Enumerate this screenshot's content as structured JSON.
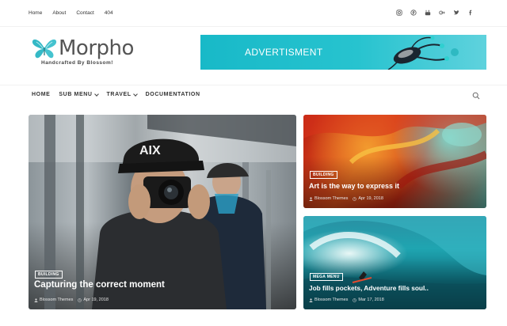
{
  "topbar": {
    "links": [
      "Home",
      "About",
      "Contact",
      "404"
    ],
    "social_icons": [
      "instagram-icon",
      "pinterest-icon",
      "youtube-icon",
      "google-plus-icon",
      "twitter-icon",
      "facebook-icon"
    ]
  },
  "header": {
    "logo_text": "Morpho",
    "tagline": "Handcrafted By Blossom!",
    "ad_text": "ADVERTISMENT"
  },
  "nav": {
    "items": [
      {
        "label": "HOME",
        "dropdown": false
      },
      {
        "label": "SUB MENU",
        "dropdown": true
      },
      {
        "label": "TRAVEL",
        "dropdown": true
      },
      {
        "label": "DOCUMENTATION",
        "dropdown": false
      }
    ]
  },
  "posts": [
    {
      "badge": "BUILDING",
      "title": "Capturing the correct moment",
      "author": "Blossom Themes",
      "date": "Apr 19, 2018"
    },
    {
      "badge": "BUILDING",
      "title": "Art is the way to express it",
      "author": "Blossom Themes",
      "date": "Apr 19, 2018"
    },
    {
      "badge": "MEGA MENU",
      "title": "Job fills pockets, Adventure fills soul..",
      "author": "Blossom Themes",
      "date": "Mar 17, 2018"
    }
  ],
  "colors": {
    "accent": "#1fbecb",
    "text": "#333333"
  }
}
